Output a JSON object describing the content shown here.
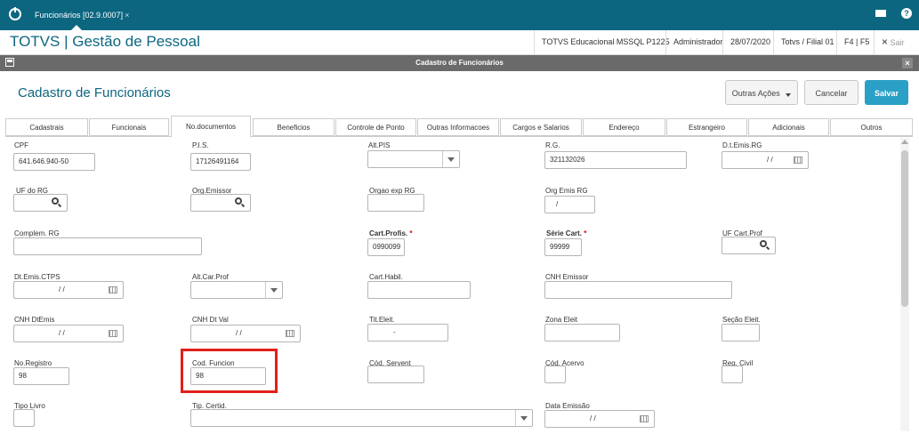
{
  "topbar": {
    "tab_label": "Funcionários [02.9.0007]",
    "tab_close": "×",
    "mail_icon": "envelope-icon",
    "help_label": "?"
  },
  "header": {
    "title": "TOTVS | Gestão de Pessoal",
    "environment": "TOTVS Educacional MSSQL P1225",
    "user": "Administrador",
    "date": "28/07/2020",
    "branch": "Totvs / Filial 01",
    "shortcut": "F4 | F5",
    "exit_x": "×",
    "exit_label": "Sair"
  },
  "window": {
    "title": "Cadastro de Funcionários",
    "close": "×"
  },
  "form": {
    "title": "Cadastro de Funcionários",
    "other_actions": "Outras Ações",
    "cancel": "Cancelar",
    "save": "Salvar"
  },
  "tabs": [
    "Cadastrais",
    "Funcionais",
    "No.documentos",
    "Beneficios",
    "Controle de Ponto",
    "Outras Informacoes",
    "Cargos e Salarios",
    "Endereço",
    "Estrangeiro",
    "Adicionais",
    "Outros"
  ],
  "fields": {
    "cpf": {
      "label": "CPF",
      "value": "641.646.940-50"
    },
    "pis": {
      "label": "P.I.S.",
      "value": "17126491164"
    },
    "alt_pis": {
      "label": "Alt.PIS",
      "value": ""
    },
    "rg": {
      "label": "R.G.",
      "value": "321132026"
    },
    "dt_emis_rg": {
      "label": "D.t.Emis.RG",
      "value": "/ /"
    },
    "uf_rg": {
      "label": "UF do RG",
      "value": ""
    },
    "org_emissor": {
      "label": "Org.Emissor",
      "value": ""
    },
    "orgao_exp_rg": {
      "label": "Orgao exp RG",
      "value": ""
    },
    "org_emis_rg": {
      "label": "Org Emis RG",
      "value": "/"
    },
    "complem_rg": {
      "label": "Complem. RG",
      "value": ""
    },
    "cart_profis": {
      "label": "Cart.Profis.",
      "required": "*",
      "value": "0990099"
    },
    "serie_cart": {
      "label": "Série Cart.",
      "required": "*",
      "value": "99999"
    },
    "uf_cart_prof": {
      "label": "UF Cart.Prof",
      "value": ""
    },
    "dt_emis_ctps": {
      "label": "Dt.Emis.CTPS",
      "value": "/ /"
    },
    "alt_car_prof": {
      "label": "Alt.Car.Prof",
      "value": ""
    },
    "cart_habil": {
      "label": "Cart.Habil.",
      "value": ""
    },
    "cnh_emissor": {
      "label": "CNH Emissor",
      "value": ""
    },
    "cnh_dtemis": {
      "label": "CNH DtEmis",
      "value": "/ /"
    },
    "cnh_dt_val": {
      "label": "CNH Dt Val",
      "value": "/ /"
    },
    "tit_eleit": {
      "label": "Tit.Eleit.",
      "value": "-"
    },
    "zona_eleit": {
      "label": "Zona Eleit",
      "value": ""
    },
    "secao_eleit": {
      "label": "Seção Eleit.",
      "value": ""
    },
    "no_registro": {
      "label": "No.Registro",
      "value": "98"
    },
    "cod_funcion": {
      "label": "Cod. Funcion",
      "value": "98"
    },
    "cod_servent": {
      "label": "Cód. Servent",
      "value": ""
    },
    "cod_acervo": {
      "label": "Cód. Acervo",
      "value": ""
    },
    "reg_civil": {
      "label": "Reg. Civil",
      "value": ""
    },
    "tipo_livro": {
      "label": "Tipo Livro",
      "value": ""
    },
    "tip_certid": {
      "label": "Tip. Certid.",
      "value": ""
    },
    "data_emissao": {
      "label": "Data Emissão",
      "value": "/ /"
    }
  }
}
